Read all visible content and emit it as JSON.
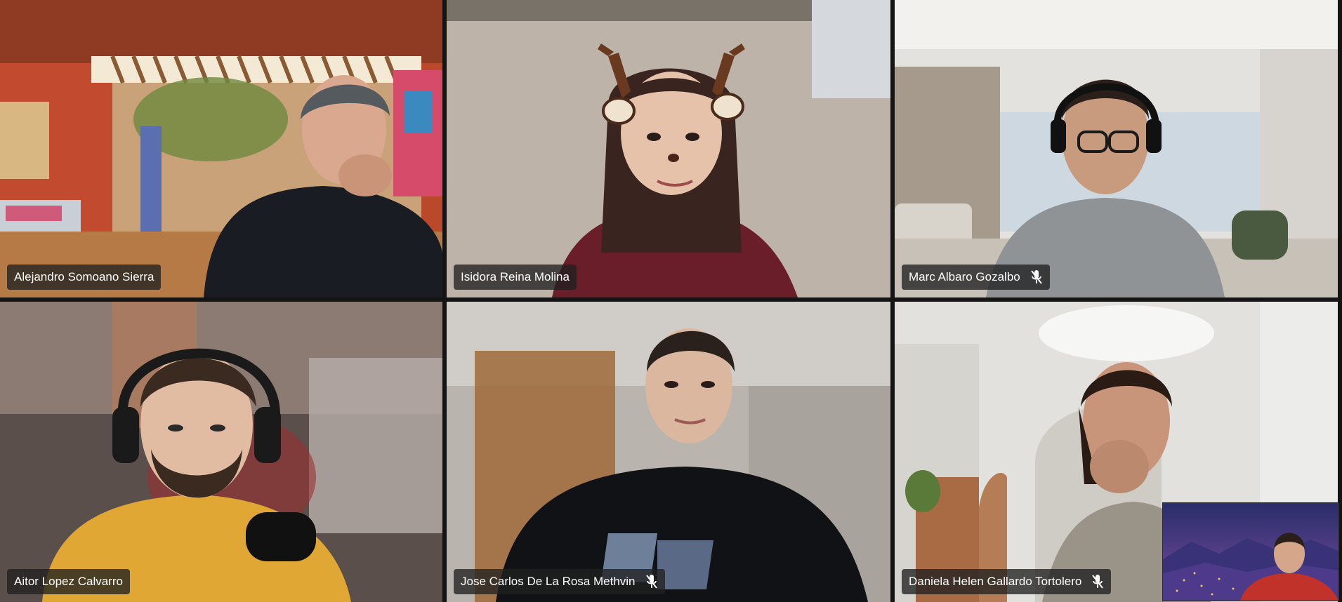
{
  "app": {
    "view": "gallery",
    "participants": [
      {
        "name": "Alejandro Somoano Sierra",
        "muted": false
      },
      {
        "name": "Isidora Reina Molina",
        "muted": false
      },
      {
        "name": "Marc Albaro Gozalbo",
        "muted": true
      },
      {
        "name": "Aitor Lopez Calvarro",
        "muted": false
      },
      {
        "name": "Jose Carlos De La Rosa Methvin",
        "muted": true
      },
      {
        "name": "Daniela Helen Gallardo Tortolero",
        "muted": true
      }
    ],
    "self_view": {
      "visible": true
    },
    "icons": {
      "muted": "mic-off-icon"
    },
    "colors": {
      "background": "#141414",
      "nameplate": "#202020",
      "text": "#ffffff"
    }
  }
}
